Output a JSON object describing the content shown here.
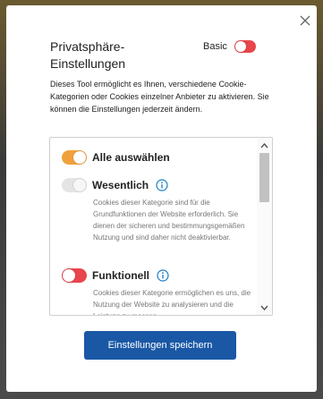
{
  "dialog": {
    "title": "Privatsphäre-Einstellungen",
    "basic_label": "Basic",
    "intro_text": "Dieses Tool ermöglicht es Ihnen, verschiedene Cookie-Kategorien oder Cookies einzelner Anbieter zu aktivieren. Sie können die Einstellungen jederzeit ändern.",
    "save_button_label": "Einstellungen speichern"
  },
  "categories": {
    "select_all": {
      "label": "Alle auswählen"
    },
    "essential": {
      "label": "Wesentlich",
      "description": "Cookies dieser Kategorie sind für die Grundfunktionen der Website erforderlich. Sie dienen der sicheren und bestimmungsgemäßen Nutzung und sind daher nicht deaktivierbar."
    },
    "functional": {
      "label": "Funktionell",
      "description": "Cookies dieser Kategorie ermöglichen es uns, die Nutzung der Website zu analysieren und die Leistung zu messen."
    }
  },
  "colors": {
    "toggle_off": "#e8454c",
    "toggle_on": "#f0a13b",
    "toggle_disabled": "#e4e4e4",
    "primary_button": "#1a58a6",
    "info_icon": "#1a7fc4"
  },
  "icons": {
    "close": "close-icon",
    "info": "info-icon",
    "scroll_up": "chevron-up-icon",
    "scroll_down": "chevron-down-icon"
  }
}
